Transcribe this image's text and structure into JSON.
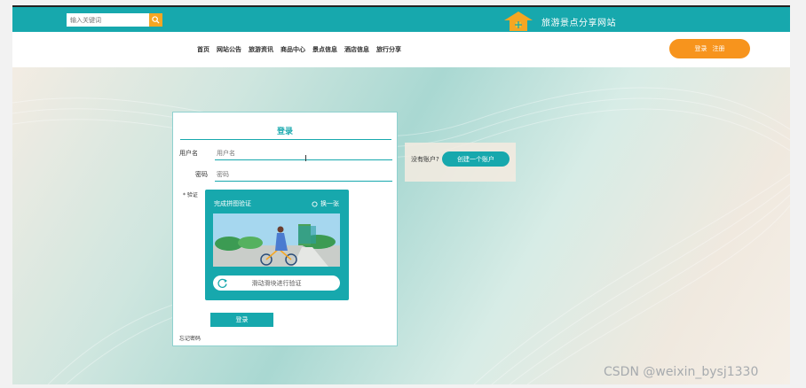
{
  "topbar": {
    "search_placeholder": "输入关键词",
    "site_title": "旅游景点分享网站",
    "icons": {
      "search": "search-icon",
      "logo": "house-logo-icon"
    }
  },
  "nav": {
    "items": [
      "首页",
      "网站公告",
      "旅游资讯",
      "商品中心",
      "景点信息",
      "酒店信息",
      "旅行分享"
    ],
    "login_label": "登录",
    "register_label": "注册"
  },
  "login_form": {
    "title": "登录",
    "username_label": "用户名",
    "username_placeholder": "用户名",
    "password_label": "密码",
    "password_placeholder": "密码",
    "captcha_label": "* 验证",
    "captcha_title": "完成拼图验证",
    "captcha_refresh": "换一张",
    "slider_text": "滑动滑块进行验证",
    "submit_label": "登录",
    "forgot_label": "忘记密码"
  },
  "register_card": {
    "prompt": "没有账户?",
    "button_label": "创建一个账户"
  },
  "watermark": "CSDN @weixin_bysj1330",
  "colors": {
    "teal": "#17a8ad",
    "orange": "#f7941d",
    "search_btn": "#f5a623"
  }
}
